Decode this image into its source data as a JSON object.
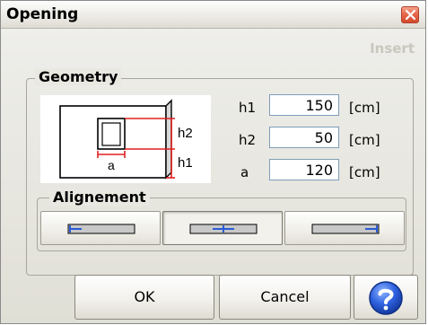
{
  "window": {
    "title": "Opening",
    "mode_label": "Insert"
  },
  "geometry": {
    "group_label": "Geometry",
    "diagram_labels": {
      "h2": "h2",
      "h1": "h1",
      "a": "a"
    },
    "fields": [
      {
        "label": "h1",
        "value": "150",
        "unit": "[cm]"
      },
      {
        "label": "h2",
        "value": "50",
        "unit": "[cm]"
      },
      {
        "label": "a",
        "value": "120",
        "unit": "[cm]"
      }
    ]
  },
  "alignment": {
    "group_label": "Alignement",
    "options": [
      "left",
      "center",
      "right"
    ],
    "selected": "center"
  },
  "buttons": {
    "ok": "OK",
    "cancel": "Cancel"
  },
  "icons": {
    "close": "close-icon",
    "align_left": "align-left-icon",
    "align_center": "align-center-icon",
    "align_right": "align-right-icon",
    "help": "help-icon"
  },
  "colors": {
    "accent_blue": "#2a5bd7",
    "diagram_red": "#e02020",
    "close_red": "#e0603f"
  }
}
